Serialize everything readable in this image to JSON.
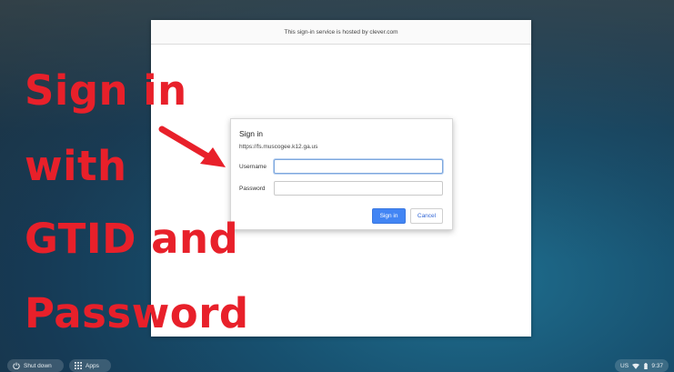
{
  "browser": {
    "hosted_notice": "This sign-in service is hosted by clever.com"
  },
  "dialog": {
    "title": "Sign in",
    "url": "https://fs.muscogee.k12.ga.us",
    "username_label": "Username",
    "username_value": "",
    "password_label": "Password",
    "password_value": "",
    "signin_button": "Sign in",
    "cancel_button": "Cancel"
  },
  "overlay": {
    "lines": [
      "Sign in",
      "with",
      "GTID and",
      "Password"
    ],
    "color": "#e8202a"
  },
  "shelf": {
    "shutdown_label": "Shut down",
    "apps_label": "Apps",
    "locale": "US",
    "time": "9:37",
    "icons": [
      "power-icon",
      "apps-grid-icon",
      "wifi-icon",
      "battery-icon"
    ]
  },
  "colors": {
    "primary_button": "#4285f4",
    "cancel_text": "#3367d6"
  }
}
